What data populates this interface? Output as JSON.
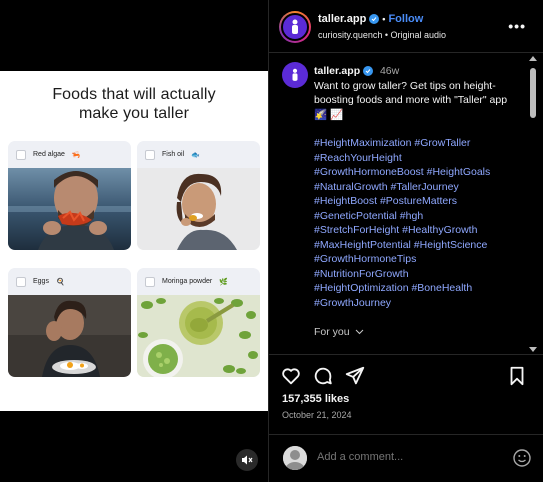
{
  "post": {
    "title_line1": "Foods that will actually",
    "title_line2": "make you taller",
    "foods": [
      {
        "label": "Red algae",
        "emoji": "🦐"
      },
      {
        "label": "Fish oil",
        "emoji": "🐟"
      },
      {
        "label": "Eggs",
        "emoji": "🍳"
      },
      {
        "label": "Moringa powder",
        "emoji": "🌿"
      }
    ]
  },
  "header": {
    "username": "taller.app",
    "follow_label": "Follow",
    "dot": "•",
    "subtitle": "curiosity.quench • Original audio",
    "more_label": "•••"
  },
  "caption": {
    "username": "taller.app",
    "time": "46w",
    "text": "Want to grow taller? Get tips on height-boosting foods and more with \"Taller\" app 🌠 📈",
    "hashtags": [
      "#HeightMaximization #GrowTaller",
      "#ReachYourHeight",
      "#GrowthHormoneBoost #HeightGoals",
      "#NaturalGrowth #TallerJourney",
      "#HeightBoost #PostureMatters",
      "#GeneticPotential #hgh",
      "#StretchForHeight #HealthyGrowth",
      "#MaxHeightPotential #HeightScience",
      "#GrowthHormoneTips",
      "#NutritionForGrowth",
      "#HeightOptimization #BoneHealth",
      "#GrowthJourney"
    ],
    "for_you": "For you"
  },
  "stats": {
    "likes": "157,355 likes",
    "date": "October 21, 2024"
  },
  "comment": {
    "placeholder": "Add a comment..."
  },
  "colors": {
    "link": "#4a8cf7",
    "hashtag": "#8fa8ff",
    "verified": "#3897f0",
    "brand": "#5b2bd6"
  },
  "icons": {
    "like": "heart-icon",
    "comment": "comment-icon",
    "share": "send-icon",
    "save": "bookmark-icon",
    "mute": "speaker-muted-icon",
    "emoji": "smiley-icon",
    "more": "more-horizontal-icon"
  }
}
